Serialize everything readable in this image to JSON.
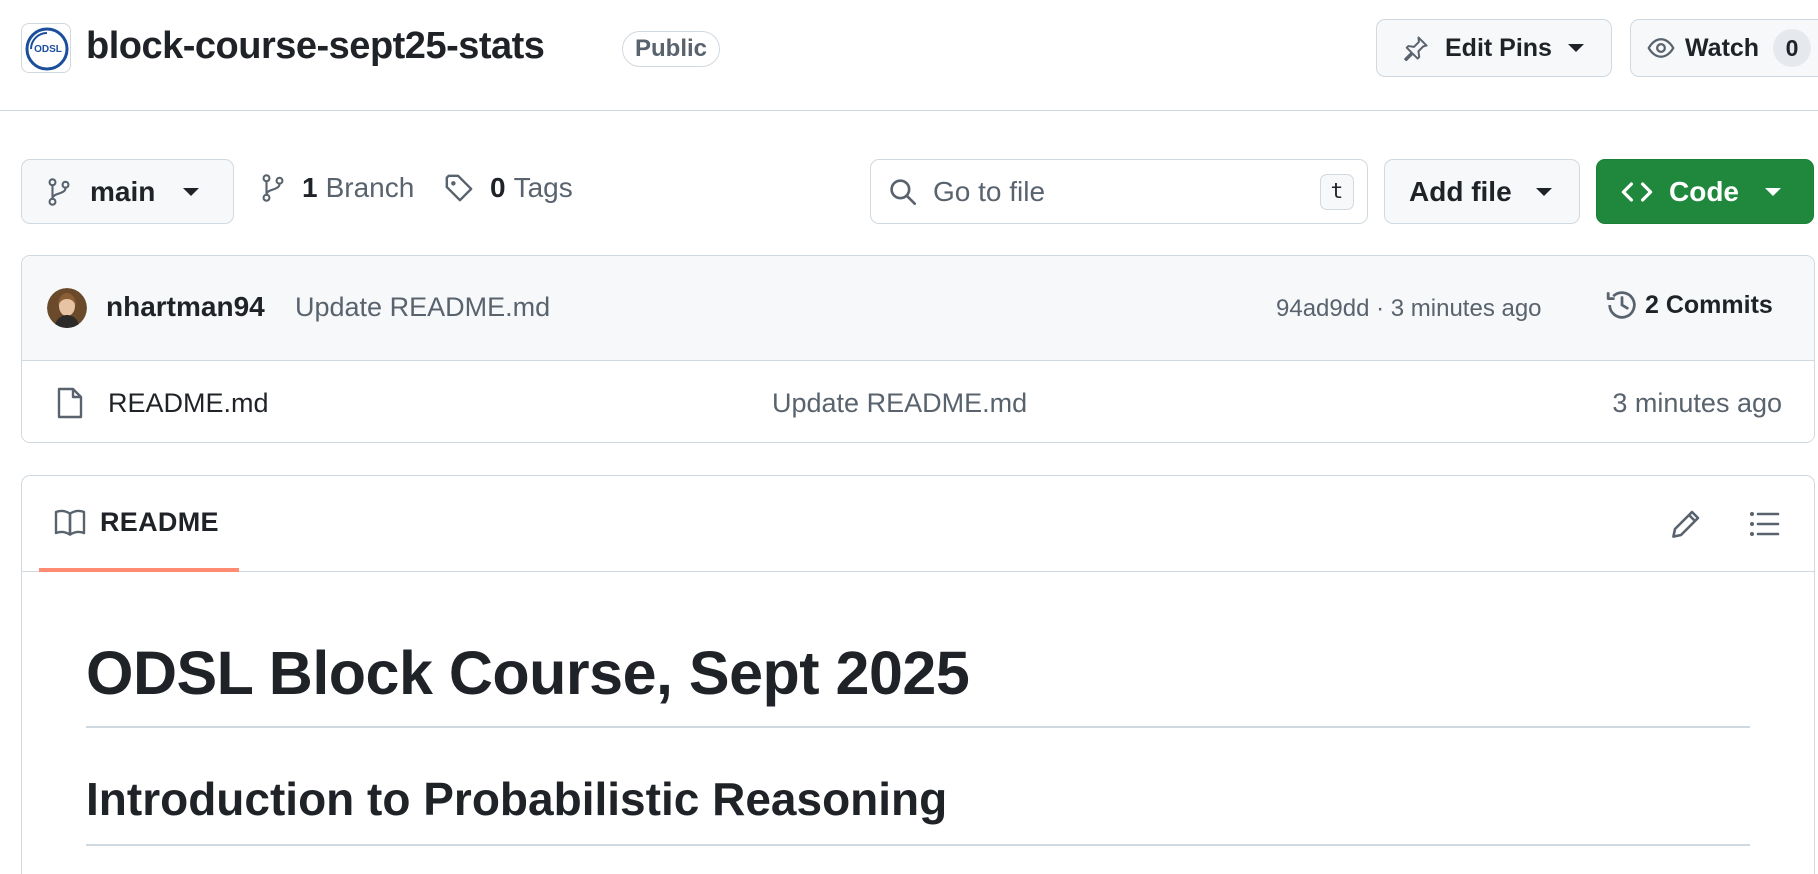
{
  "repo": {
    "name": "block-course-sept25-stats",
    "visibility": "Public",
    "org_logo_text": "ODSL"
  },
  "header_actions": {
    "edit_pins_label": "Edit Pins",
    "watch_label": "Watch",
    "watch_count": "0"
  },
  "toolbar": {
    "branch": "main",
    "branch_count": "1",
    "branch_label": "Branch",
    "tag_count": "0",
    "tag_label": "Tags",
    "search_placeholder": "Go to file",
    "search_shortcut": "t",
    "add_file_label": "Add file",
    "code_label": "Code"
  },
  "latest_commit": {
    "author": "nhartman94",
    "message": "Update README.md",
    "meta": "94ad9dd · 3 minutes ago",
    "commits_label": "2 Commits"
  },
  "files": [
    {
      "name": "README.md",
      "commit_message": "Update README.md",
      "age": "3 minutes ago"
    }
  ],
  "readme": {
    "tab_label": "README",
    "h1": "ODSL Block Course, Sept 2025",
    "h2": "Introduction to Probabilistic Reasoning"
  },
  "colors": {
    "primary_green": "#1f883d",
    "readme_tab_accent": "#fd8c73",
    "border": "#d1d9e0",
    "muted_text": "#59636e"
  }
}
